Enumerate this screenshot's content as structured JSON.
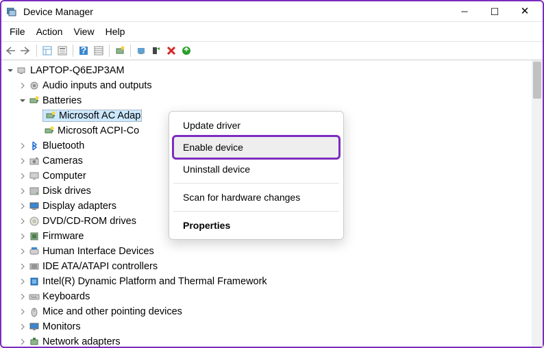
{
  "window": {
    "title": "Device Manager"
  },
  "menubar": {
    "items": [
      "File",
      "Action",
      "View",
      "Help"
    ]
  },
  "toolbar": {
    "buttons": [
      "back",
      "forward",
      "sep",
      "show-hidden",
      "properties",
      "sep",
      "help",
      "details",
      "sep",
      "scan",
      "sep",
      "update-driver",
      "uninstall",
      "disable",
      "enable"
    ]
  },
  "tree": {
    "root": {
      "label": "LAPTOP-Q6EJP3AM",
      "expanded": true
    },
    "items": [
      {
        "label": "Audio inputs and outputs",
        "icon": "speaker",
        "expanded": false,
        "hasChildren": true
      },
      {
        "label": "Batteries",
        "icon": "battery",
        "expanded": true,
        "hasChildren": true,
        "children": [
          {
            "label": "Microsoft AC Adap",
            "icon": "battery",
            "selected": true
          },
          {
            "label": "Microsoft ACPI-Co",
            "icon": "battery"
          }
        ]
      },
      {
        "label": "Bluetooth",
        "icon": "bluetooth",
        "expanded": false,
        "hasChildren": true
      },
      {
        "label": "Cameras",
        "icon": "camera",
        "expanded": false,
        "hasChildren": true
      },
      {
        "label": "Computer",
        "icon": "computer",
        "expanded": false,
        "hasChildren": true
      },
      {
        "label": "Disk drives",
        "icon": "disk",
        "expanded": false,
        "hasChildren": true
      },
      {
        "label": "Display adapters",
        "icon": "display",
        "expanded": false,
        "hasChildren": true
      },
      {
        "label": "DVD/CD-ROM drives",
        "icon": "dvd",
        "expanded": false,
        "hasChildren": true
      },
      {
        "label": "Firmware",
        "icon": "firmware",
        "expanded": false,
        "hasChildren": true
      },
      {
        "label": "Human Interface Devices",
        "icon": "hid",
        "expanded": false,
        "hasChildren": true
      },
      {
        "label": "IDE ATA/ATAPI controllers",
        "icon": "ide",
        "expanded": false,
        "hasChildren": true
      },
      {
        "label": "Intel(R) Dynamic Platform and Thermal Framework",
        "icon": "intel",
        "expanded": false,
        "hasChildren": true
      },
      {
        "label": "Keyboards",
        "icon": "keyboard",
        "expanded": false,
        "hasChildren": true
      },
      {
        "label": "Mice and other pointing devices",
        "icon": "mouse",
        "expanded": false,
        "hasChildren": true
      },
      {
        "label": "Monitors",
        "icon": "monitor",
        "expanded": false,
        "hasChildren": true
      },
      {
        "label": "Network adapters",
        "icon": "network",
        "expanded": false,
        "hasChildren": true
      }
    ]
  },
  "context_menu": {
    "items": [
      {
        "label": "Update driver",
        "kind": "item"
      },
      {
        "label": "Enable device",
        "kind": "item",
        "highlight": true,
        "hover": true
      },
      {
        "label": "Uninstall device",
        "kind": "item"
      },
      {
        "kind": "sep"
      },
      {
        "label": "Scan for hardware changes",
        "kind": "item"
      },
      {
        "kind": "sep"
      },
      {
        "label": "Properties",
        "kind": "item",
        "bold": true
      }
    ]
  }
}
